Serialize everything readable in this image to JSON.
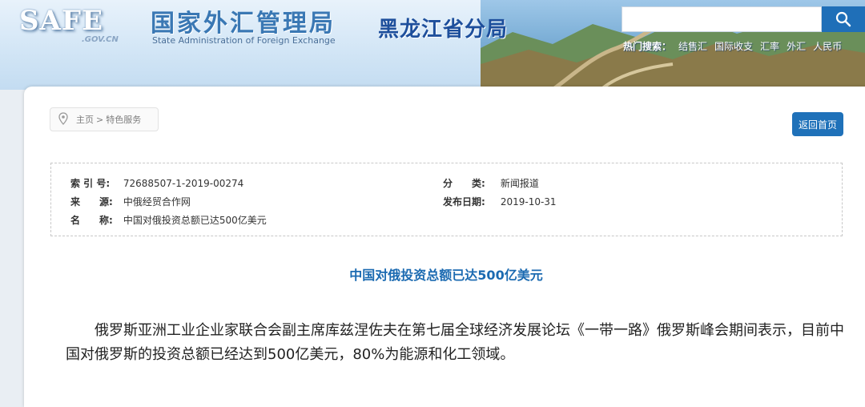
{
  "header": {
    "logo_text": "SAFE",
    "logo_domain": ".GOV.CN",
    "site_title_cn": "国家外汇管理局",
    "site_title_en": "State Administration of Foreign Exchange",
    "branch_name": "黑龙江省分局",
    "search_placeholder": "",
    "hot_label": "热门搜索：",
    "hot_keywords": [
      "结售汇",
      "国际收支",
      "汇率",
      "外汇",
      "人民币"
    ]
  },
  "breadcrumb": {
    "home": "主页",
    "separator": ">",
    "current": "特色服务"
  },
  "back_button": "返回首页",
  "meta": {
    "index_label": "索 引 号:",
    "index_value": "72688507-1-2019-00274",
    "source_label": "来　　源:",
    "source_value": "中俄经贸合作网",
    "name_label": "名　　称:",
    "name_value": "中国对俄投资总额已达500亿美元",
    "category_label": "分　　类:",
    "category_value": "新闻报道",
    "date_label": "发布日期:",
    "date_value": "2019-10-31"
  },
  "article": {
    "title": "中国对俄投资总额已达500亿美元",
    "paragraph": "俄罗斯亚洲工业企业家联合会副主席库兹涅佐夫在第七届全球经济发展论坛《一带一路》俄罗斯峰会期间表示，目前中国对俄罗斯的投资总额已经达到500亿美元，80%为能源和化工领域。"
  },
  "colors": {
    "accent_blue": "#1f71b9",
    "title_blue": "#1b6ab1",
    "branch_blue": "#1e4f9c"
  }
}
